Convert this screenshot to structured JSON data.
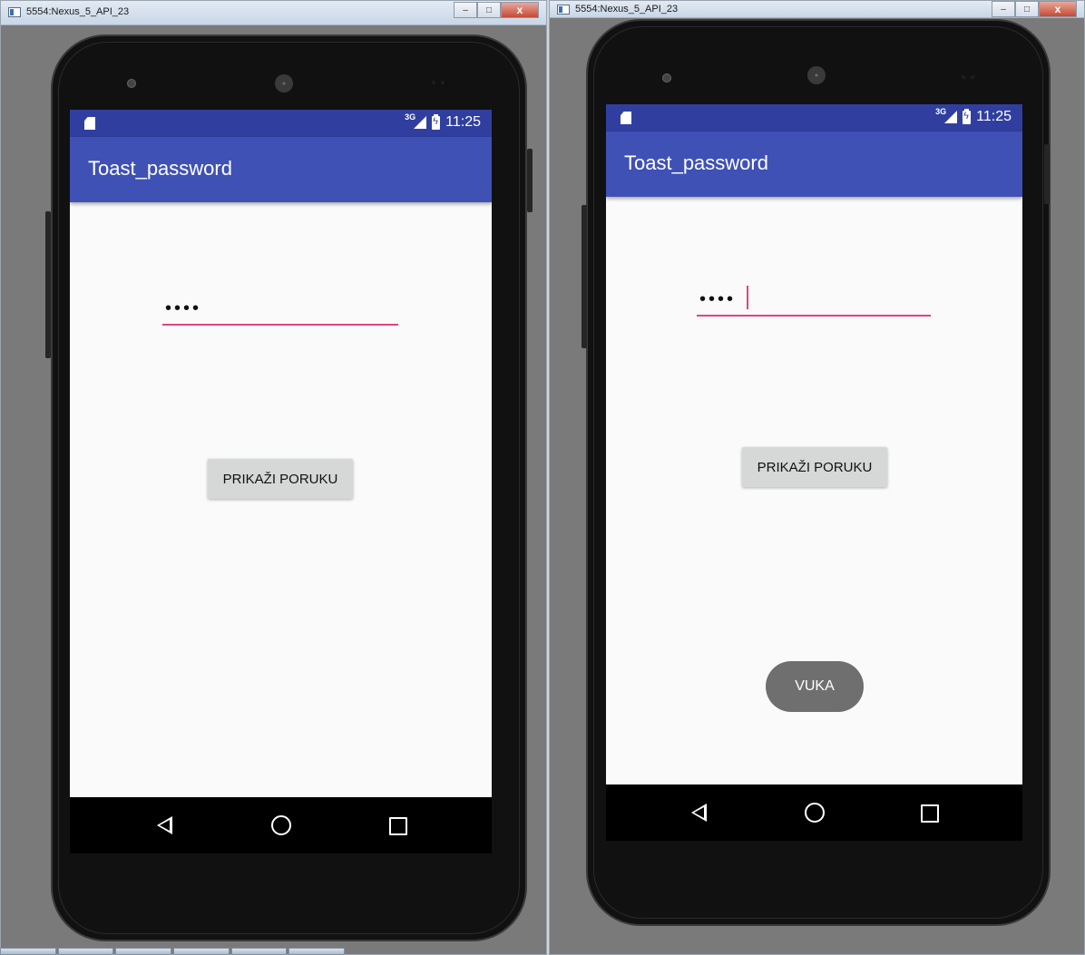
{
  "windows": [
    {
      "title": "5554:Nexus_5_API_23",
      "status_time": "11:25",
      "network_label": "3G",
      "app_title": "Toast_password",
      "password_value": "••••",
      "button_label": "PRIKAŽI PORUKU",
      "toast": ""
    },
    {
      "title": "5554:Nexus_5_API_23",
      "status_time": "11:25",
      "network_label": "3G",
      "app_title": "Toast_password",
      "password_value": "••••",
      "button_label": "PRIKAŽI PORUKU",
      "toast": "VUKA"
    }
  ],
  "window_controls": {
    "minimize": "–",
    "maximize": "□",
    "close": "x"
  },
  "colors": {
    "status_bar": "#303f9f",
    "app_bar": "#3f51b5",
    "accent": "#e0457b",
    "toast_bg": "#6f6f6f",
    "button_bg": "#d6d7d7"
  }
}
